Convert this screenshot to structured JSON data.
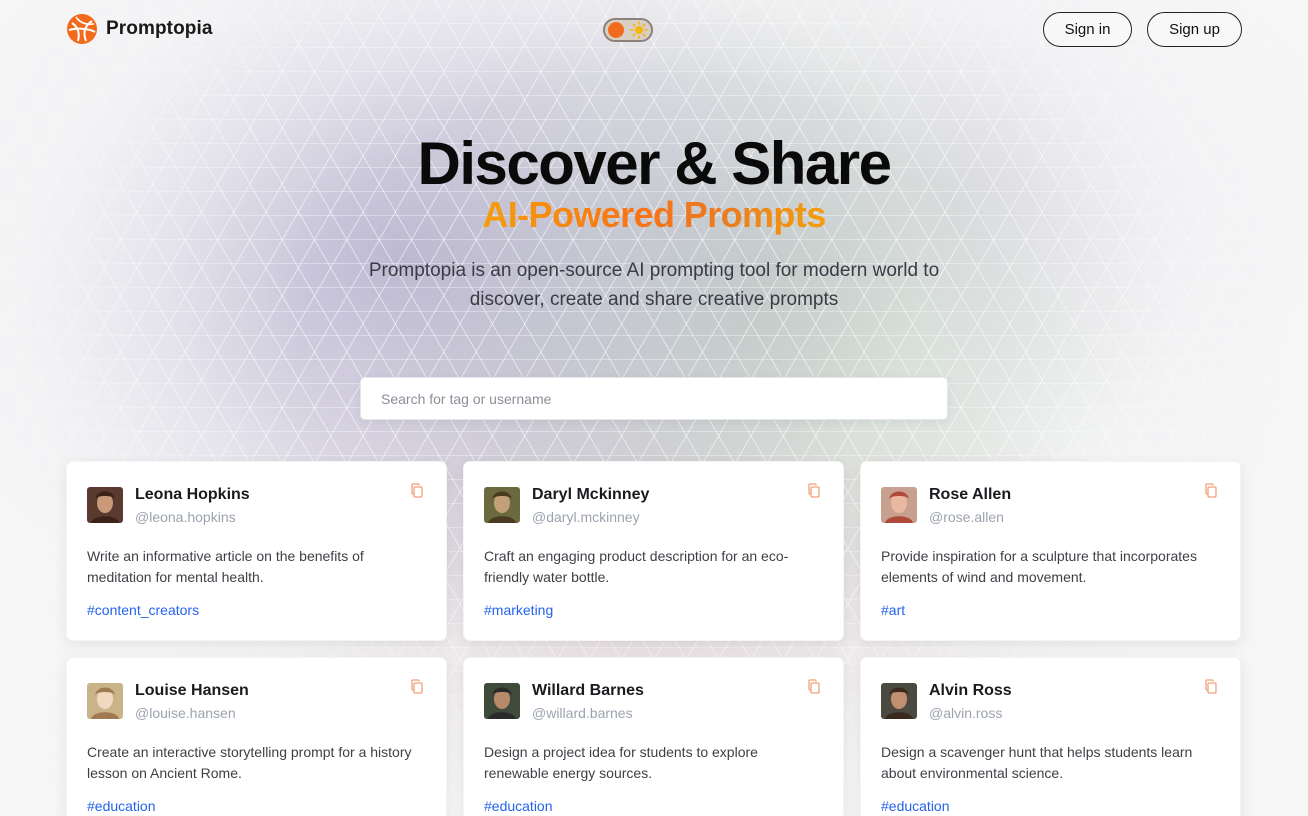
{
  "brand": {
    "name": "Promptopia"
  },
  "nav": {
    "theme_toggle": {
      "state": "light",
      "icons": [
        "toggle-knob",
        "sun-icon"
      ]
    },
    "sign_in_label": "Sign in",
    "sign_up_label": "Sign up"
  },
  "hero": {
    "title": "Discover & Share",
    "subtitle": "AI-Powered Prompts",
    "description": "Promptopia is an open-source AI prompting tool for modern world to discover, create and share creative prompts"
  },
  "search": {
    "placeholder": "Search for tag or username",
    "value": ""
  },
  "colors": {
    "accent_orange": "#f97316",
    "tag_blue": "#2563eb",
    "logo_orange": "#f26b1d"
  },
  "prompts": [
    {
      "name": "Leona Hopkins",
      "handle": "@leona.hopkins",
      "text": "Write an informative article on the benefits of meditation for mental health.",
      "tag": "#content_creators",
      "avatar": "avatar-photo"
    },
    {
      "name": "Daryl Mckinney",
      "handle": "@daryl.mckinney",
      "text": "Craft an engaging product description for an eco-friendly water bottle.",
      "tag": "#marketing",
      "avatar": "avatar-photo"
    },
    {
      "name": "Rose Allen",
      "handle": "@rose.allen",
      "text": "Provide inspiration for a sculpture that incorporates elements of wind and movement.",
      "tag": "#art",
      "avatar": "avatar-photo"
    },
    {
      "name": "Louise Hansen",
      "handle": "@louise.hansen",
      "text": "Create an interactive storytelling prompt for a history lesson on Ancient Rome.",
      "tag": "#education",
      "avatar": "avatar-photo"
    },
    {
      "name": "Willard Barnes",
      "handle": "@willard.barnes",
      "text": "Design a project idea for students to explore renewable energy sources.",
      "tag": "#education",
      "avatar": "avatar-photo"
    },
    {
      "name": "Alvin Ross",
      "handle": "@alvin.ross",
      "text": "Design a scavenger hunt that helps students learn about environmental science.",
      "tag": "#education",
      "avatar": "avatar-photo"
    }
  ]
}
